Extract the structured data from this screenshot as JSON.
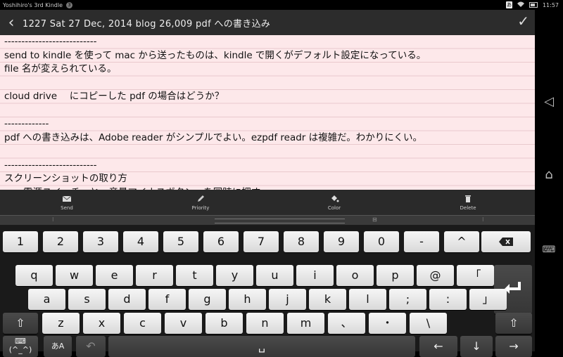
{
  "status": {
    "device_name": "Yoshihiro's 3rd Kindle",
    "badge": "3",
    "ime": "あ",
    "time": "11:57"
  },
  "header": {
    "title": "1227  Sat  27  Dec, 2014   blog  26,009    pdf への書き込み"
  },
  "editor": {
    "lines": [
      "---------------------------",
      "send to kindle を使って mac から送ったものは、kindle で開くがデフォルト設定になっている。",
      "file 名が変えられている。",
      "",
      "cloud drive　 にコピーした pdf の場合はどうか？",
      "",
      "-------------",
      "pdf への書き込みは、Adobe reader がシンプルでよい。ezpdf readr は複雑だ。わかりにくい。",
      "",
      "---------------------------",
      "スクリーンショットの取り方",
      "　　電源スイッチ　と　音量マイナスボタン　を同時に押す",
      "",
      "---------------------------"
    ]
  },
  "toolbar": {
    "send": "Send",
    "priority": "Priority",
    "color": "Color",
    "delete": "Delete"
  },
  "keyboard": {
    "row1": [
      "1",
      "2",
      "3",
      "4",
      "5",
      "6",
      "7",
      "8",
      "9",
      "0",
      "-",
      "^"
    ],
    "row2": [
      "q",
      "w",
      "e",
      "r",
      "t",
      "y",
      "u",
      "i",
      "o",
      "p",
      "@",
      "「"
    ],
    "row3": [
      "a",
      "s",
      "d",
      "f",
      "g",
      "h",
      "j",
      "k",
      "l",
      ";",
      ":",
      "」"
    ],
    "row4": [
      "z",
      "x",
      "c",
      "v",
      "b",
      "n",
      "m",
      "、",
      "・",
      "\\"
    ],
    "emoji_label": "(^_^)",
    "mode_label": "あA"
  }
}
